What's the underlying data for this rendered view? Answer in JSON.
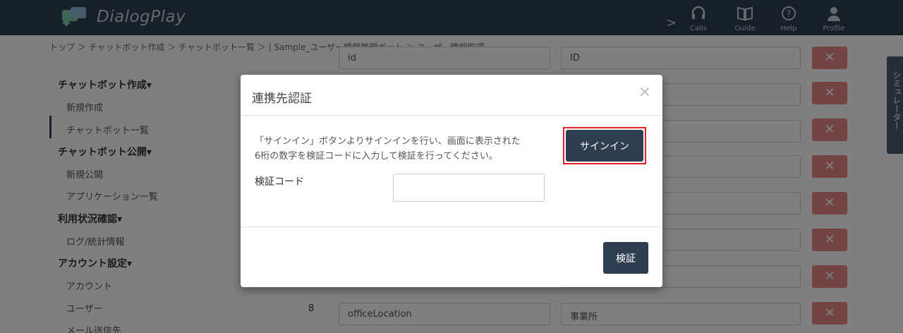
{
  "header": {
    "brand": "DialogPlay",
    "arrow": ">",
    "nav": [
      {
        "label": "Calls",
        "icon": "headset-icon"
      },
      {
        "label": "Guide",
        "icon": "book-icon"
      },
      {
        "label": "Help",
        "icon": "help-icon"
      },
      {
        "label": "Profile",
        "icon": "user-icon"
      }
    ]
  },
  "breadcrumb": "トップ ＞ チャットボット作成 ＞ チャットボット一覧 ＞ | Sample_ユーザー情報管理ボット ＞ ユーザー情報取得",
  "sidebar": {
    "sections": [
      {
        "title": "チャットボット作成▾",
        "items": [
          "新規作成",
          "チャットボット一覧"
        ]
      },
      {
        "title": "チャットボット公開▾",
        "items": [
          "新規公開",
          "アプリケーション一覧"
        ]
      },
      {
        "title": "利用状況確認▾",
        "items": [
          "ログ/統計情報"
        ]
      },
      {
        "title": "アカウント設定▾",
        "items": [
          "アカウント",
          "ユーザー",
          "メール送信先"
        ]
      }
    ]
  },
  "background": {
    "field_top_left": "id",
    "field_top_right": "ID",
    "row_number": "8",
    "field_bottom_left": "officeLocation",
    "field_bottom_right": "事業所",
    "delete_symbol": "✕",
    "simulator_tab": "シミュレーター"
  },
  "modal": {
    "title": "連携先認証",
    "close": "×",
    "description_line1": "「サインイン」ボタンよりサインインを行い、画面に表示された",
    "description_line2": "6桁の数字を検証コードに入力して検証を行ってください。",
    "signin_label": "サインイン",
    "code_label": "検証コード",
    "code_value": "",
    "verify_label": "検証"
  }
}
